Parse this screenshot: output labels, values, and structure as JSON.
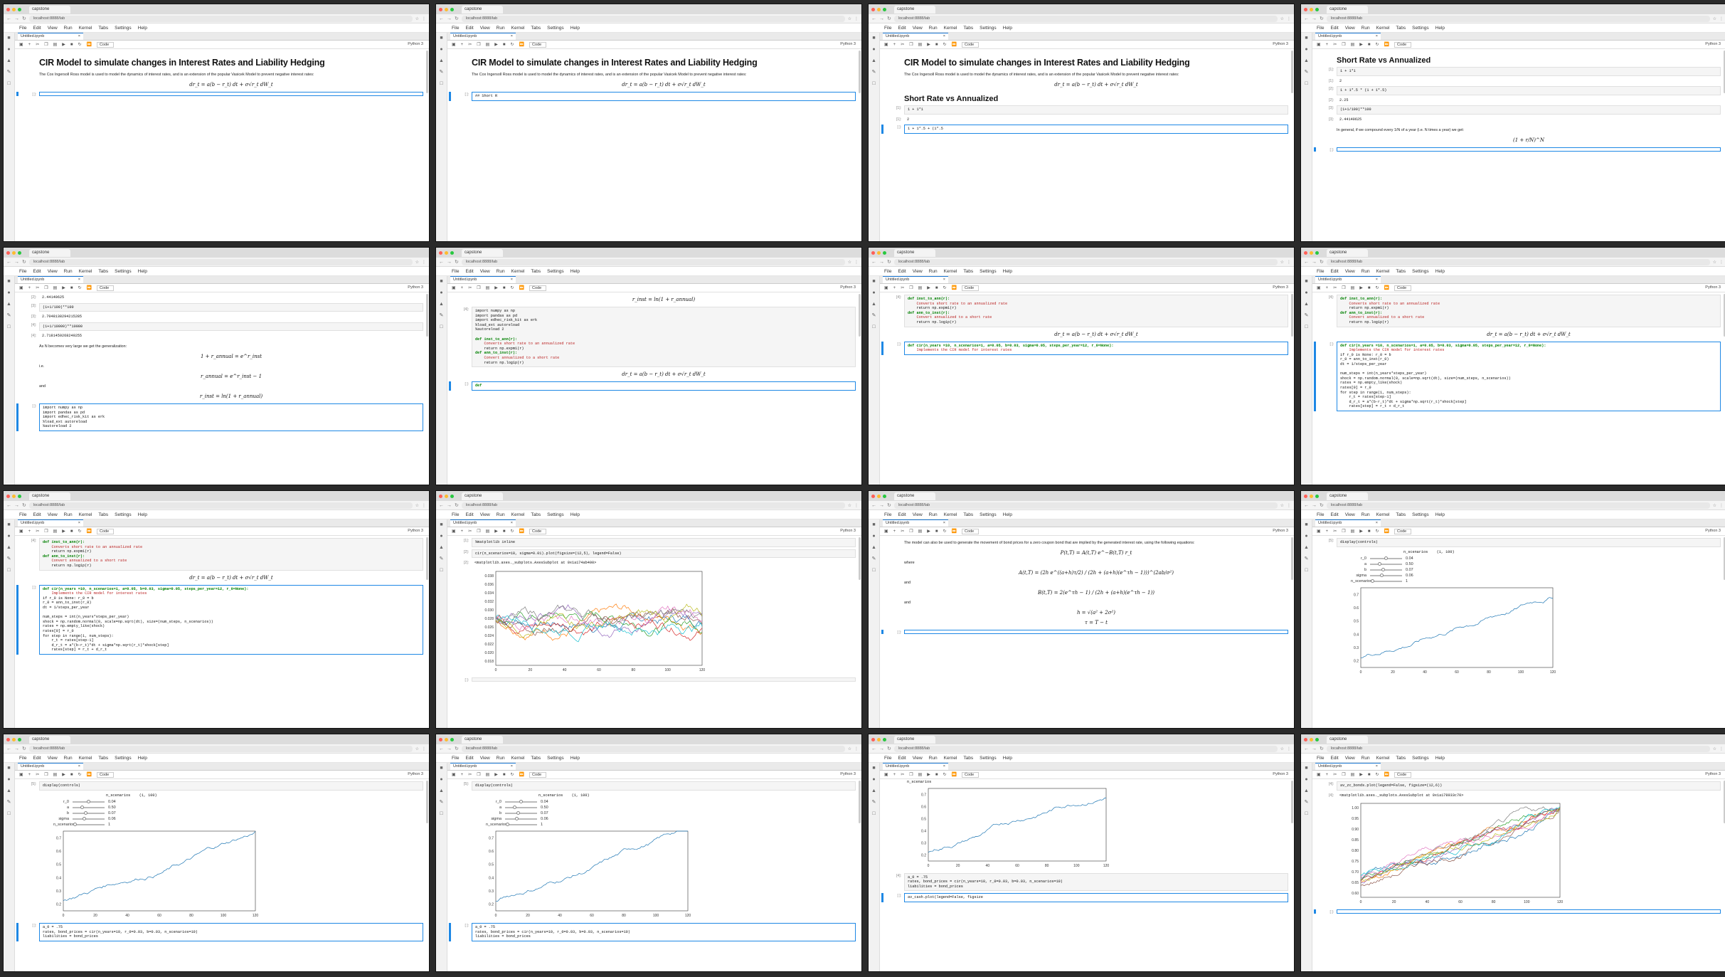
{
  "browser": {
    "tab_title": "capstone",
    "url": "localhost:8888/lab",
    "notebook_tab": "Untitled.ipynb",
    "menu": [
      "File",
      "Edit",
      "View",
      "Run",
      "Kernel",
      "Tabs",
      "Settings",
      "Help"
    ],
    "cell_type": "Code",
    "kernel": "Python 3"
  },
  "notebook": {
    "title": "CIR Model to simulate changes in Interest Rates and Liability Hedging",
    "intro": "The Cox Ingersoll Ross model is used to model the dynamics of interest rates, and is an extension of the popular Vasicek Model to prevent negative interest rates:",
    "cir_equation": "dr_t = a(b − r_t) dt + σ√r_t dW_t",
    "md_short_r": "## Short R",
    "short_rate_heading": "Short Rate vs Annualized",
    "general_text": "In general, if we compound every 1/N of a year (i.e. N times a year) we get:",
    "compound_formula": "(1 + r/N)^N",
    "generalization_text": "As N becomes very large we get the generalization:",
    "gen_eq1": "1 + r_annual = e^r_inst",
    "gen_eq2": "r_annual = e^r_inst − 1",
    "gen_eq3": "r_inst = ln(1 + r_annual)",
    "word_ie": "i.e.",
    "word_and": "and",
    "word_where": "where",
    "zcb_text": "The model can also be used to generate the movement of bond prices for a zero coupon bond that are implied by the generated interest rate, using the following equations:",
    "bond_eq": "P(t,T) = A(t,T) e^−B(t,T) r_t",
    "a_eq": "A(t,T) = (2h e^((a+h)τ/2) / (2h + (a+h)(e^τh − 1)))^(2ab/σ²)",
    "b_eq": "B(t,T) = 2(e^τh − 1) / (2h + (a+h)(e^τh − 1))",
    "h_eq": "h = √(a² + 2σ²)",
    "tau_eq": "τ = T − t"
  },
  "cells": {
    "c1": "1 + 1*1",
    "o1": "2",
    "c2": "1 + 1*.5 * (1 + 1*.5)",
    "c2b": "1 + 1*.5 + (1*.5",
    "o2": "2.25",
    "c3": "(1+1/100)**100",
    "o3": "2.7048138294215285",
    "c4": "(1+1/10000)**10000",
    "o4": "2.7181459268249255",
    "o_partial": "2.44140625",
    "imports": "import numpy as np\nimport pandas as pd\nimport edhec_risk_kit as erk\n%load_ext autoreload\n%autoreload 2",
    "funcs_line1": "def inst_to_ann(r):",
    "funcs_doc1": "Converts short rate to an annualized rate",
    "funcs_ret1": "return np.expm1(r)",
    "funcs_line2": "def ann_to_inst(r):",
    "funcs_doc2": "Convert annualized to a short rate",
    "funcs_ret2": "return np.log1p(r)",
    "cir_def": "def cir(n_years =10, n_scenarios=1, a=0.05, b=0.03, sigma=0.05, steps_per_year=12, r_0=None):",
    "cir_doc": "Implements the CIR model for interest rates",
    "cir_body": "if r_0 is None: r_0 = b\nr_0 = ann_to_inst(r_0)\ndt = 1/steps_per_year\n\nnum_steps = int(n_years*steps_per_year)\nshock = np.random.normal(0, scale=np.sqrt(dt), size=(num_steps, n_scenarios))\nrates = np.empty_like(shock)\nrates[0] = r_0\nfor step in range(1, num_steps):\n    r_t = rates[step-1]\n    d_r_t = a*(b-r_t)*dt + sigma*np.sqrt(r_t)*shock[step]\n    rates[step] = r_t + d_r_t",
    "mpl": "%matplotlib inline",
    "plot_cmd": "cir(n_scenarios=10, sigma=0.01).plot(figsize=(12,5), legend=False)",
    "plot_out": "<matplotlib.axes._subplots.AxesSubplot at 0x1a174ab400>",
    "display_controls": "display(controls)",
    "n_scenarios_label": "n_scenarios",
    "bond_cmd": "a_0 = .75\nrates, bond_prices = cir(n_years=10, r_0=0.03, b=0.03, n_scenarios=10)\nliabilities = bond_prices",
    "plot2_cmd": "av_zc_bonds.plot(legend=False, figsize=(12,6))",
    "plot2_out": "<matplotlib.axes._subplots.AxesSubplot at 0x1a178933c70>",
    "last_cmd": "av_cash.plot(legend=False, figsize"
  },
  "controls": [
    {
      "label": "r_0",
      "value": "0.04",
      "pos": 0.45
    },
    {
      "label": "a",
      "value": "0.50",
      "pos": 0.25
    },
    {
      "label": "b",
      "value": "0.07",
      "pos": 0.35
    },
    {
      "label": "sigma",
      "value": "0.06",
      "pos": 0.3
    },
    {
      "label": "n_scenarios",
      "value": "1",
      "pos": 0.02
    }
  ],
  "slider_header": "n_scenarios    (1, 100)",
  "chart_data": [
    {
      "type": "line",
      "title": "",
      "x_ticks": [
        0,
        20,
        40,
        60,
        80,
        100,
        120
      ],
      "y_ticks": [
        "0.018",
        "0.020",
        "0.022",
        "0.024",
        "0.026",
        "0.028",
        "0.030",
        "0.032",
        "0.034",
        "0.036",
        "0.038"
      ],
      "ylim": [
        0.017,
        0.039
      ],
      "xlim": [
        0,
        120
      ],
      "series_count": 10
    },
    {
      "type": "line",
      "x_ticks": [
        0,
        20,
        40,
        60,
        80,
        100,
        120
      ],
      "y_ticks": [
        "0.2",
        "0.3",
        "0.4",
        "0.5",
        "0.6",
        "0.7"
      ],
      "ylim": [
        0.15,
        0.75
      ],
      "xlim": [
        0,
        120
      ],
      "series_count": 1
    },
    {
      "type": "line",
      "x_ticks": [
        0,
        20,
        40,
        60,
        80,
        100,
        120
      ],
      "y_ticks": [
        "0.60",
        "0.65",
        "0.70",
        "0.75",
        "0.80",
        "0.85",
        "0.90",
        "0.95",
        "1.00"
      ],
      "ylim": [
        0.58,
        1.02
      ],
      "xlim": [
        0,
        120
      ],
      "series_count": 10
    }
  ],
  "prompts": {
    "p1": "[1]:",
    "p2": "[2]:",
    "p3": "[3]:",
    "p4": "[4]:",
    "p5": "[5]:",
    "p_empty": "[ ]:"
  }
}
